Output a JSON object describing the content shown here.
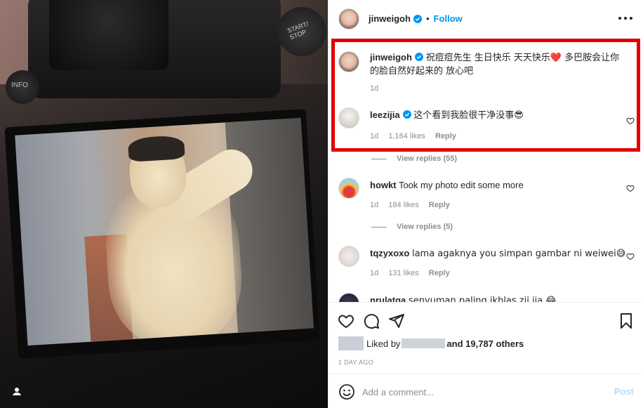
{
  "post": {
    "author": "jinweigoh",
    "follow_label": "Follow",
    "dot": "•"
  },
  "comments": [
    {
      "username": "jinweigoh",
      "text": "祝痘痘先生 生日快乐 天天快乐❤️ 多巴胺会让你的脸自然好起来的 放心吧",
      "time": "1d"
    },
    {
      "username": "leezijia",
      "text": "这个看到我脸很干净没事😎",
      "time": "1d",
      "likes": "1,164 likes",
      "reply": "Reply"
    },
    {
      "view_replies": "View replies (55)"
    },
    {
      "username": "howkt",
      "text": "Took my photo edit some more",
      "time": "1d",
      "likes": "184 likes",
      "reply": "Reply"
    },
    {
      "view_replies": "View replies (5)"
    },
    {
      "username": "tqzyxoxo",
      "text": "lama agaknya you simpan gambar ni weiwei😅",
      "time": "1d",
      "likes": "131 likes",
      "reply": "Reply"
    },
    {
      "username": "nrulatqa",
      "text": "senyuman paling ikhlas zii jia 😂"
    }
  ],
  "likes_bar": {
    "liked_by": "Liked by",
    "and_others": "and 19,787 others"
  },
  "timestamp": "1 DAY AGO",
  "comment_input": {
    "placeholder": "Add a comment...",
    "post_label": "Post"
  },
  "photo_text": {
    "info": "INFO",
    "start_stop": "START/ STOP"
  },
  "colors": {
    "accent": "#0095f6",
    "highlight": "#e00000",
    "post_disabled": "#b2dffc"
  }
}
